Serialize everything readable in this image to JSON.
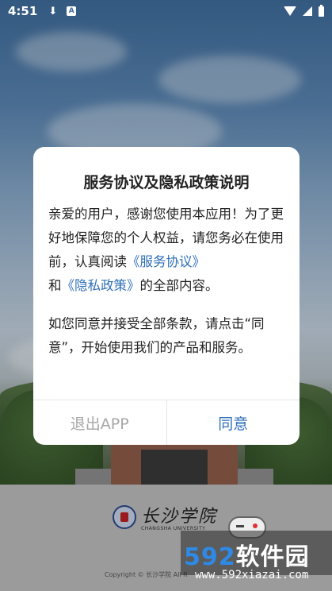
{
  "status_bar": {
    "time": "4:51",
    "download_icon": "download-icon",
    "notification_badge": "A",
    "wifi_icon": "wifi-icon",
    "signal_icon": "signal-icon",
    "battery_icon": "battery-icon"
  },
  "dialog": {
    "title": "服务协议及隐私政策说明",
    "para1_text_a": "亲爱的用户，感谢您使用本应用！为了更好地保障您的个人权益，请您务必在使用前，认真阅读",
    "link_service": "《服务协议》",
    "para1_text_b": "和",
    "link_privacy": "《隐私政策》",
    "para1_text_c": "的全部内容。",
    "para2": "如您同意并接受全部条款，请点击“同意”，开始使用我们的产品和服务。",
    "exit_label": "退出APP",
    "agree_label": "同意"
  },
  "footer": {
    "logo_cn": "长沙学院",
    "logo_en": "CHANGSHA UNIVERSITY",
    "copyright": "Copyright © 长沙学院 All R"
  },
  "watermark": {
    "main_num": "592",
    "main_cn": "软件园",
    "url": "www.592xiazai.com"
  },
  "colors": {
    "link": "#2f6fb8",
    "exit_text": "#a6a6a6"
  }
}
